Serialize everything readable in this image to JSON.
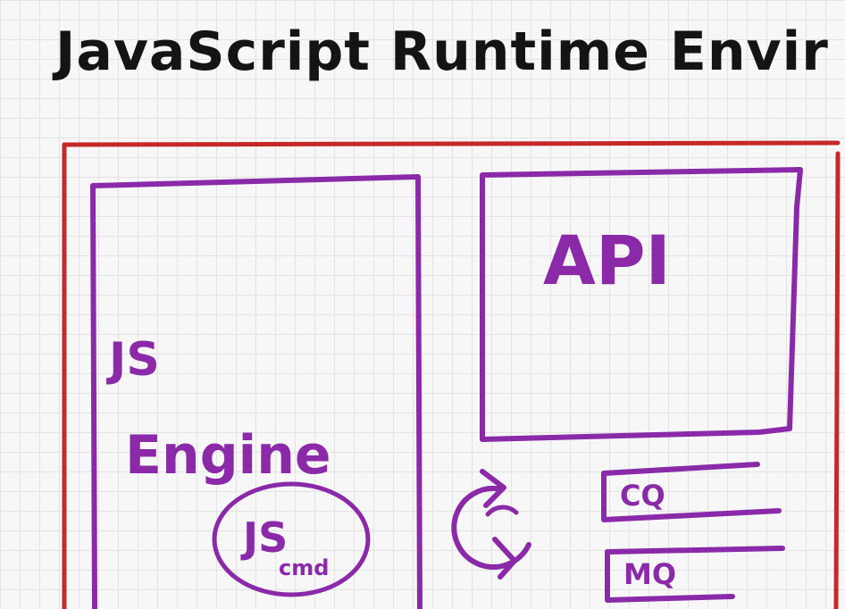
{
  "title": "JavaScript Runtime Envir",
  "outer_box": {
    "color": "#c62828"
  },
  "js_engine": {
    "line1": "JS",
    "line2": "Engine",
    "color": "#8a2aa8"
  },
  "js_inner": {
    "line1": "JS",
    "line2": "cmd"
  },
  "api": {
    "label": "API"
  },
  "event_loop": {
    "icon": "refresh-cycle"
  },
  "queues": [
    {
      "label": "CQ"
    },
    {
      "label": "MQ"
    }
  ]
}
